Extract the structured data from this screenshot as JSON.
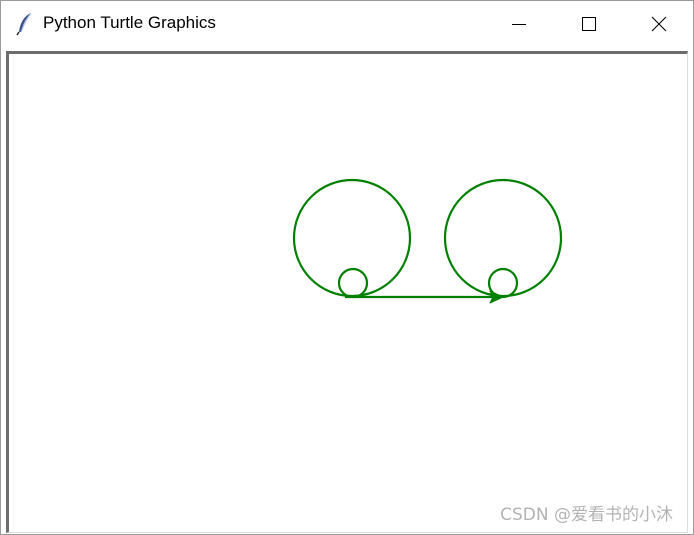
{
  "window": {
    "title": "Python Turtle Graphics",
    "app_icon": "feather-icon",
    "controls": [
      "minimize-icon",
      "maximize-icon",
      "close-icon"
    ]
  },
  "drawing": {
    "pen_color": "#008000",
    "shapes": [
      "large-circle-left",
      "small-circle-left",
      "large-circle-right",
      "small-circle-right",
      "baseline-with-arrow"
    ]
  },
  "watermark": "CSDN @爱看书的小沐"
}
